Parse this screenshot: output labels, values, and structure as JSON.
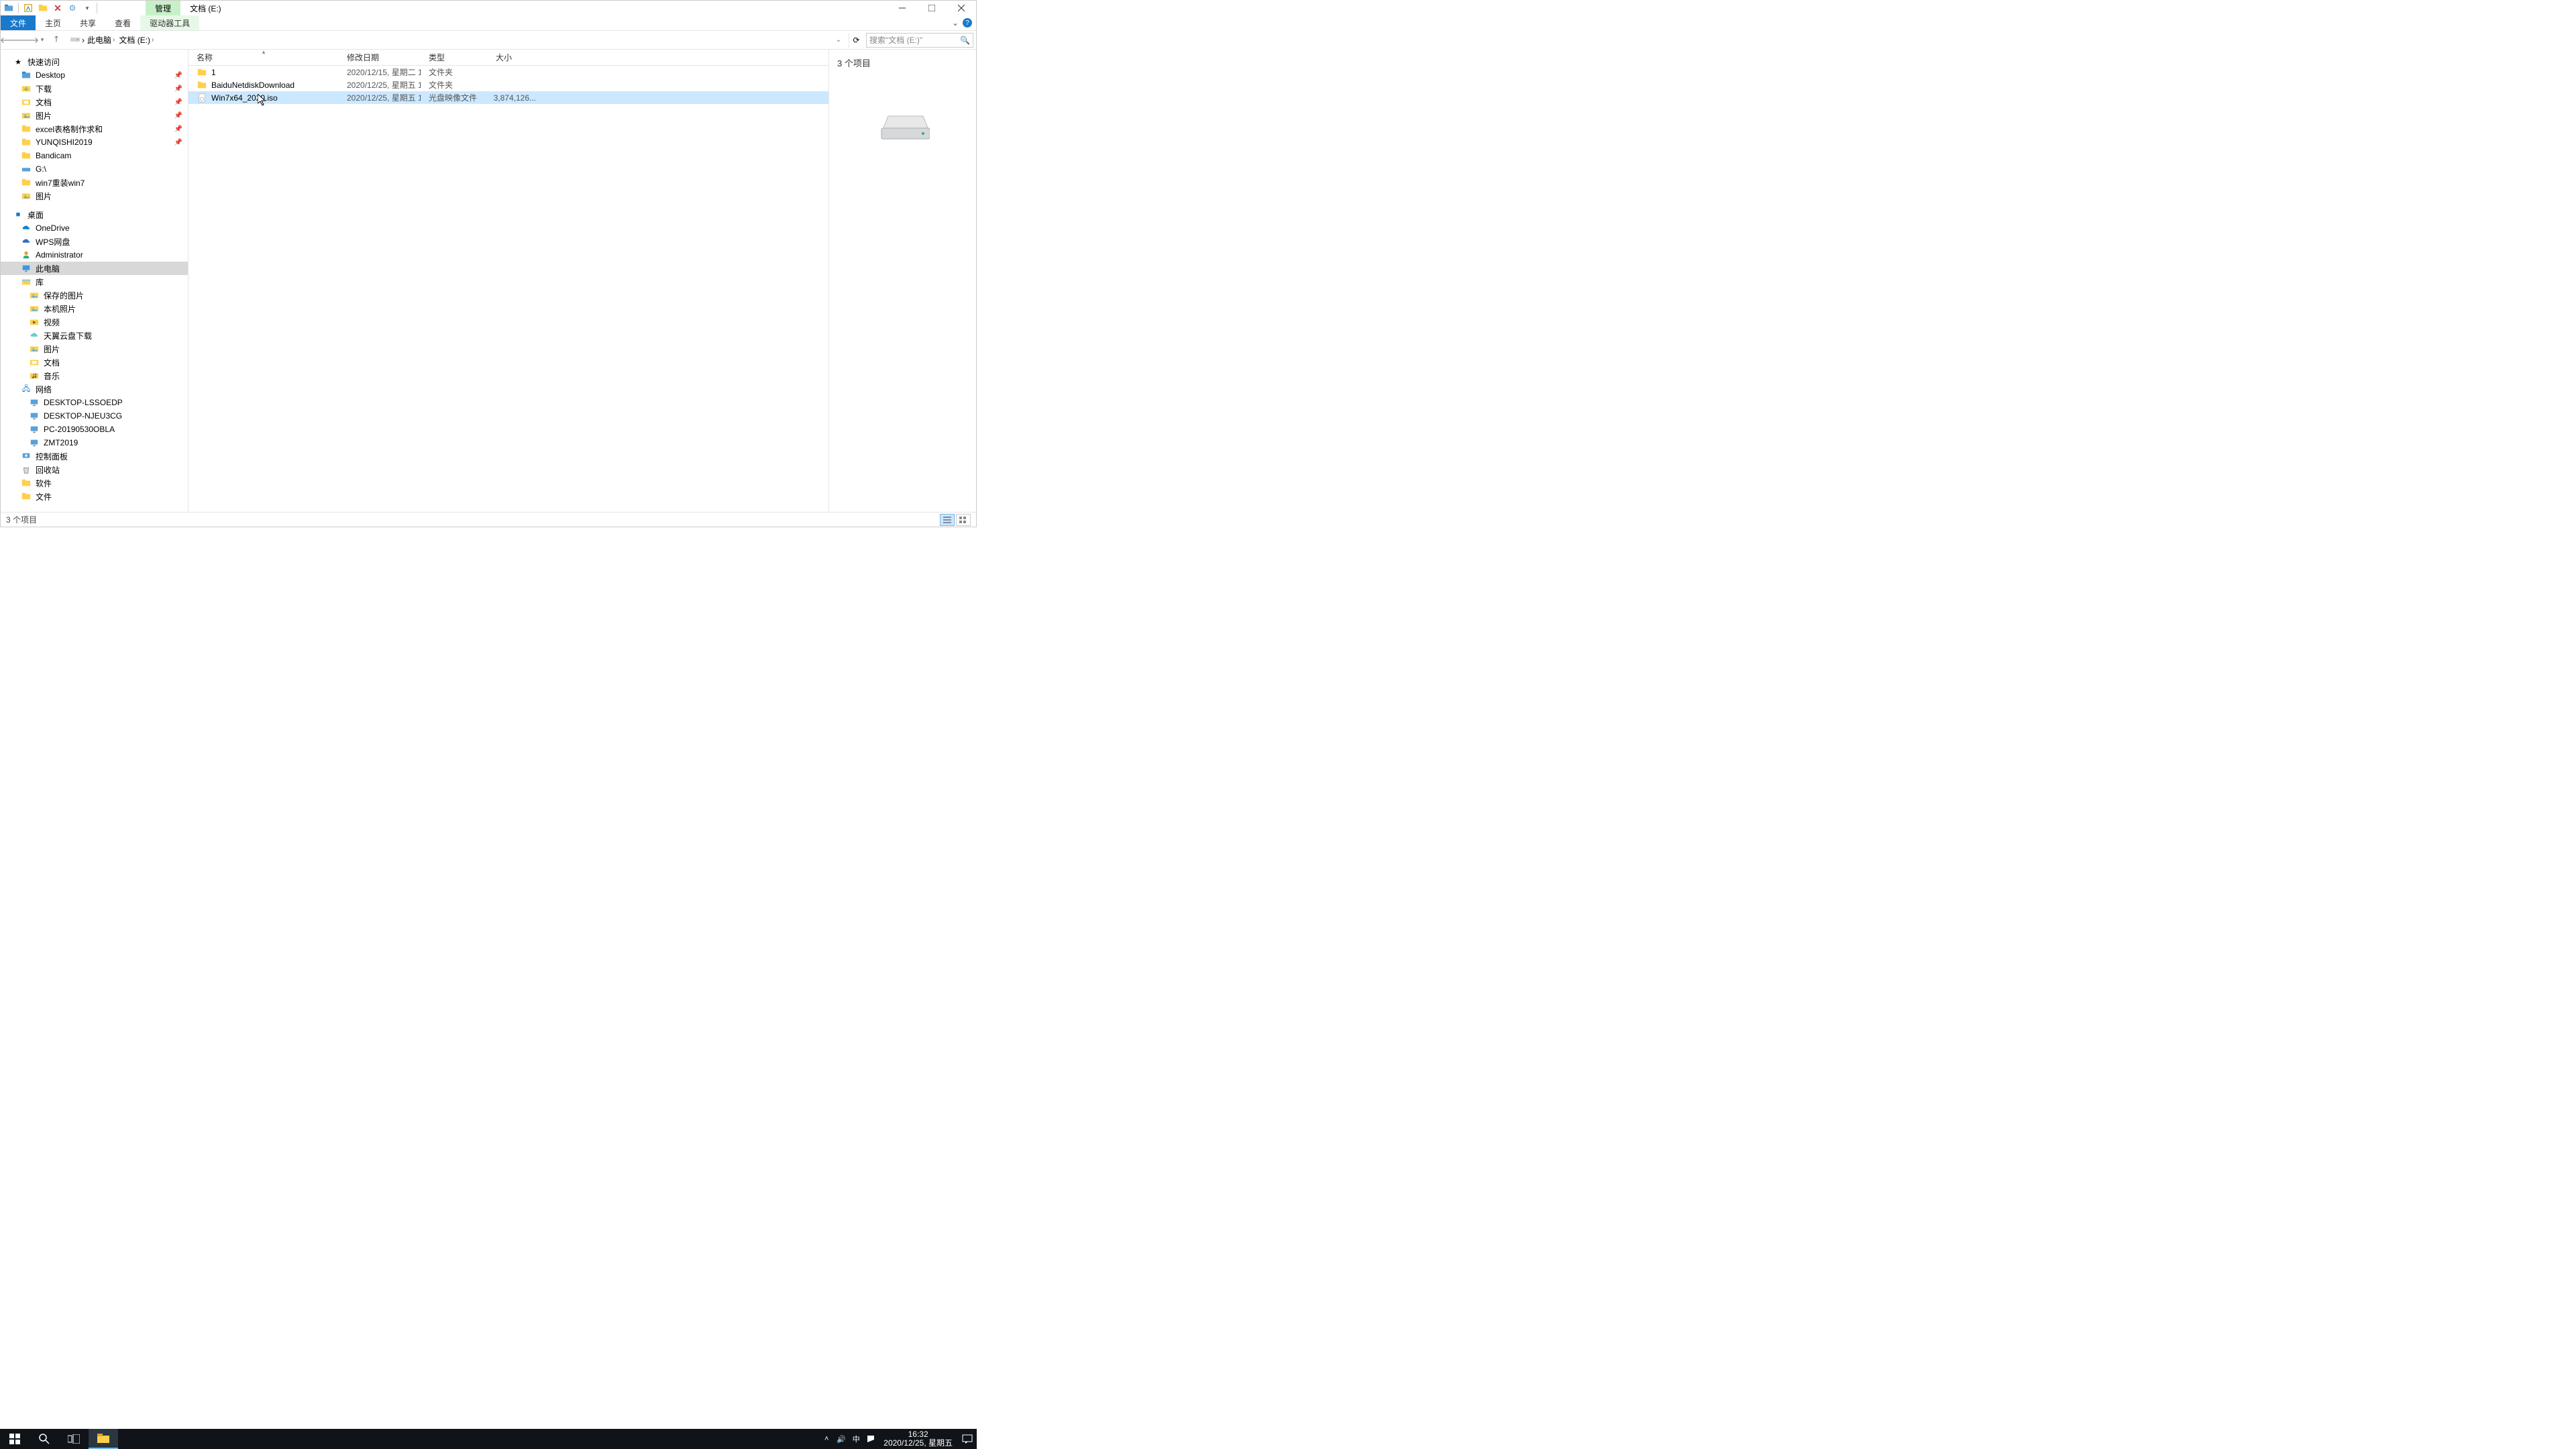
{
  "title": {
    "context_tab": "管理",
    "window_title": "文档 (E:)"
  },
  "ribbon": {
    "file": "文件",
    "home": "主页",
    "share": "共享",
    "view": "查看",
    "drive_tools": "驱动器工具"
  },
  "nav": {
    "crumbs": [
      "此电脑",
      "文档 (E:)"
    ],
    "refresh_dropdown": "⌄",
    "search_placeholder": "搜索\"文档 (E:)\""
  },
  "columns": {
    "name": "名称",
    "date": "修改日期",
    "type": "类型",
    "size": "大小"
  },
  "files": [
    {
      "icon": "folder",
      "name": "1",
      "date": "2020/12/15, 星期二 1...",
      "type": "文件夹",
      "size": "",
      "selected": false
    },
    {
      "icon": "folder",
      "name": "BaiduNetdiskDownload",
      "date": "2020/12/25, 星期五 1...",
      "type": "文件夹",
      "size": "",
      "selected": false
    },
    {
      "icon": "disc",
      "name": "Win7x64_2020.iso",
      "date": "2020/12/25, 星期五 1...",
      "type": "光盘映像文件",
      "size": "3,874,126...",
      "selected": true
    }
  ],
  "tree": {
    "quick": {
      "label": "快速访问",
      "items": [
        {
          "icon": "folder-blue",
          "label": "Desktop",
          "pinned": true
        },
        {
          "icon": "download",
          "label": "下载",
          "pinned": true
        },
        {
          "icon": "doc",
          "label": "文档",
          "pinned": true
        },
        {
          "icon": "pic",
          "label": "图片",
          "pinned": true
        },
        {
          "icon": "folder",
          "label": "excel表格制作求和",
          "pinned": true
        },
        {
          "icon": "folder",
          "label": "YUNQISHI2019",
          "pinned": true
        },
        {
          "icon": "folder",
          "label": "Bandicam",
          "pinned": false
        },
        {
          "icon": "drive-blue",
          "label": "G:\\",
          "pinned": false
        },
        {
          "icon": "folder",
          "label": "win7重装win7",
          "pinned": false
        },
        {
          "icon": "pic",
          "label": "图片",
          "pinned": false
        }
      ]
    },
    "desktop": {
      "label": "桌面",
      "items": [
        {
          "icon": "onedrive",
          "label": "OneDrive"
        },
        {
          "icon": "wps",
          "label": "WPS网盘"
        },
        {
          "icon": "user",
          "label": "Administrator"
        },
        {
          "icon": "pc",
          "label": "此电脑",
          "selected": true
        },
        {
          "icon": "library",
          "label": "库"
        }
      ]
    },
    "libs": [
      {
        "icon": "pic",
        "label": "保存的图片"
      },
      {
        "icon": "pic",
        "label": "本机照片"
      },
      {
        "icon": "video",
        "label": "视频"
      },
      {
        "icon": "cloud",
        "label": "天翼云盘下载"
      },
      {
        "icon": "pic",
        "label": "图片"
      },
      {
        "icon": "doc",
        "label": "文档"
      },
      {
        "icon": "music",
        "label": "音乐"
      }
    ],
    "network": {
      "label": "网络",
      "items": [
        {
          "icon": "netpc",
          "label": "DESKTOP-LSSOEDP"
        },
        {
          "icon": "netpc",
          "label": "DESKTOP-NJEU3CG"
        },
        {
          "icon": "netpc",
          "label": "PC-20190530OBLA"
        },
        {
          "icon": "netpc",
          "label": "ZMT2019"
        }
      ]
    },
    "extra": [
      {
        "icon": "cpl",
        "label": "控制面板"
      },
      {
        "icon": "recycle",
        "label": "回收站"
      },
      {
        "icon": "folder",
        "label": "软件"
      },
      {
        "icon": "folder",
        "label": "文件"
      }
    ]
  },
  "preview": {
    "count_label": "3 个项目"
  },
  "status": {
    "text": "3 个项目"
  },
  "taskbar": {
    "time": "16:32",
    "date": "2020/12/25, 星期五",
    "ime": "中"
  }
}
